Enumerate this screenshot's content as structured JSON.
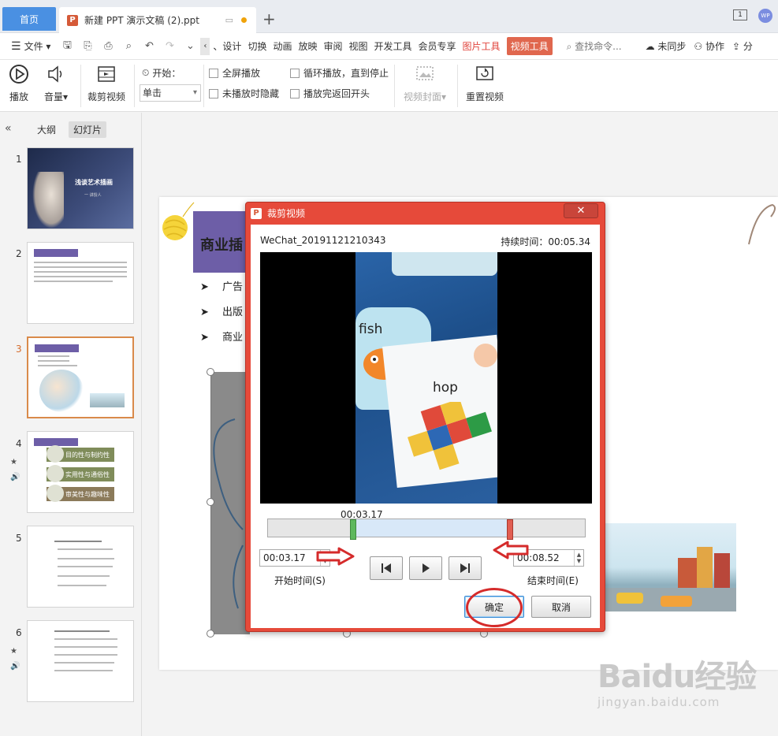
{
  "titlebar": {
    "home_tab": "首页",
    "doc_tab": "新建 PPT 演示文稿 (2).ppt",
    "avatar_text": "WP",
    "window_icon_text": "1"
  },
  "menubar": {
    "file_label": "文件",
    "items": [
      "、设计",
      "切换",
      "动画",
      "放映",
      "审阅",
      "视图",
      "开发工具",
      "会员专享"
    ],
    "picture_tools": "图片工具",
    "video_tools": "视频工具",
    "search_placeholder": "查找命令...",
    "sync": "未同步",
    "collab": "协作",
    "share": "分"
  },
  "ribbon": {
    "play": "播放",
    "volume": "音量",
    "trim_video": "裁剪视频",
    "start_label": "开始：",
    "start_value": "单击",
    "fullscreen": "全屏播放",
    "hide_when_not_playing": "未播放时隐藏",
    "loop": "循环播放，直到停止",
    "rewind": "播放完返回开头",
    "video_cover": "视频封面",
    "reset_video": "重置视频"
  },
  "leftpanel": {
    "tab_outline": "大纲",
    "tab_slides": "幻灯片",
    "slides": [
      {
        "num": "1",
        "title": "浅谈艺术插画",
        "sub": "一 讲授人"
      },
      {
        "num": "2"
      },
      {
        "num": "3"
      },
      {
        "num": "4",
        "items": [
          "目的性与制约性",
          "实用性与通俗性",
          "审美性与趣味性"
        ]
      },
      {
        "num": "5"
      },
      {
        "num": "6"
      }
    ]
  },
  "slide": {
    "title": "商业插",
    "bullets": [
      "广告",
      "出版",
      "商业"
    ]
  },
  "dialog": {
    "title": "裁剪视频",
    "close": "✕",
    "filename": "WeChat_20191121210343",
    "duration": "持续时间：00:05.34",
    "current_time": "00:03.17",
    "start_time": "00:03.17",
    "end_time": "00:08.52",
    "start_label": "开始时间(S)",
    "end_label": "结束时间(E)",
    "ok": "确定",
    "cancel": "取消",
    "video_text_fish": "fish",
    "video_text_hop": "hop"
  },
  "watermark": {
    "logo": "Baidu经验",
    "url": "jingyan.baidu.com"
  },
  "colors": {
    "accent_blue": "#4a90e2",
    "dialog_red": "#e64a3a",
    "slide_purple": "#6d5ea7",
    "annotation_red": "#d52b2b"
  }
}
